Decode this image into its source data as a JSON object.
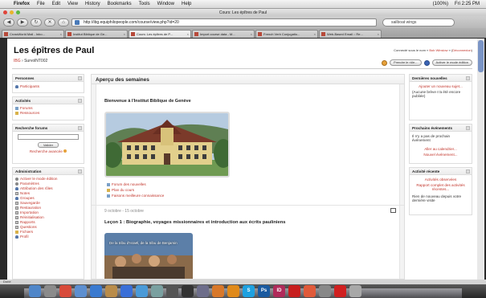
{
  "menubar": {
    "apple": "",
    "app_name": "Firefox",
    "menus": [
      "File",
      "Edit",
      "View",
      "History",
      "Bookmarks",
      "Tools",
      "Window",
      "Help"
    ],
    "clock": "Fri 2:25 PM",
    "battery": "(100%)"
  },
  "window": {
    "title": "Cours: Les épîtres de Paul"
  },
  "toolbar": {
    "url": "http://ibg.equiphilopeople.com/course/view.php?id=20",
    "search_value": "sailboat wings"
  },
  "tabs": [
    {
      "label": "CrossWorld Mail - Inbo...",
      "active": false
    },
    {
      "label": "Institut Biblique de Ge...",
      "active": false
    },
    {
      "label": "Cours: Les épîtres de P...",
      "active": true
    },
    {
      "label": "Import course data - M...",
      "active": false
    },
    {
      "label": "French Verb Conjugatio...",
      "active": false
    },
    {
      "label": "Web-Based Email :: Re...",
      "active": false
    }
  ],
  "header": {
    "site_title": "Les épîtres de Paul",
    "breadcrumb_home": "IBG",
    "breadcrumb_sep": " › ",
    "breadcrumb_course": "SurvolNT002",
    "login_prefix": "Connecté sous le nom « ",
    "login_user": "Bob Winslow",
    "login_suffix": " » (",
    "logout": "Déconnexion",
    "logout_close": ")",
    "role_button": "Prendre le rôle...",
    "edit_button": "Activer le mode édition"
  },
  "left": {
    "people": {
      "title": "Personnes",
      "items": [
        "Participants"
      ]
    },
    "activities": {
      "title": "Activités",
      "items": [
        "Forums",
        "Ressources"
      ]
    },
    "search": {
      "title": "Recherche forums",
      "button": "Valider",
      "advanced": "Recherche avancée"
    },
    "admin": {
      "title": "Administration",
      "items": [
        "Activer le mode édition",
        "Paramètres",
        "Attribution des rôles",
        "Notes",
        "Groupes",
        "Sauvegarde",
        "Restauration",
        "Importation",
        "Réinitialisation",
        "Rapports",
        "Questions",
        "Fichiers",
        "Profil"
      ]
    }
  },
  "main": {
    "heading": "Aperçu des semaines",
    "welcome": "Bienvenue à l'Institut Biblique de Genève",
    "section0_links": [
      "Forum des nouvelles",
      "Plan du cours",
      "Faisons meilleure connaissance"
    ],
    "section1_date": "9 octobre - 15 octobre",
    "section1_title": "Leçon 1 : Biographie, voyages missionnaires et introduction aux écrits pauliniens",
    "image_caption": "De la tribu d'Israël, de la tribu de Benjamin"
  },
  "right": {
    "news": {
      "title": "Dernières nouvelles",
      "add": "Ajouter un nouveau sujet...",
      "empty": "(Aucune brève n'a été encore publiée)"
    },
    "events": {
      "title": "Prochains événements",
      "empty": "Il n'y a pas de prochain événement",
      "calendar": "Aller au calendrier...",
      "new": "Nouvel événement..."
    },
    "recent": {
      "title": "Activité récente",
      "observed": "Activités observées",
      "full_report": "Rapport complet des activités récentes...",
      "nothing": "Rien de nouveau depuis votre dernière visite"
    }
  },
  "status": "Done",
  "colors": {
    "link": "#c2342a",
    "accent_blue": "#3b64b4"
  },
  "dock": [
    {
      "name": "finder-icon",
      "color": "#4f86c9",
      "glyph": ""
    },
    {
      "name": "system-prefs-icon",
      "color": "#8b8b8b",
      "glyph": ""
    },
    {
      "name": "ical-icon",
      "color": "#d84a3a",
      "glyph": ""
    },
    {
      "name": "mail-icon",
      "color": "#5d8fd0",
      "glyph": ""
    },
    {
      "name": "ichat-icon",
      "color": "#3a7ad0",
      "glyph": ""
    },
    {
      "name": "address-book-icon",
      "color": "#b98c4a",
      "glyph": ""
    },
    {
      "name": "itunes-icon",
      "color": "#3a6fd8",
      "glyph": ""
    },
    {
      "name": "safari-icon",
      "color": "#4a9ad8",
      "glyph": ""
    },
    {
      "name": "preview-icon",
      "color": "#7aa0a0",
      "glyph": ""
    },
    {
      "name": "photo-booth-icon",
      "color": "#555",
      "glyph": ""
    },
    {
      "name": "terminal-icon",
      "color": "#333",
      "glyph": ""
    },
    {
      "name": "utility-icon",
      "color": "#6d6d8a",
      "glyph": ""
    },
    {
      "name": "firefox-icon",
      "color": "#d8782a",
      "glyph": ""
    },
    {
      "name": "vlc-icon",
      "color": "#e08a1a",
      "glyph": ""
    },
    {
      "name": "skype-icon",
      "color": "#1ea1e0",
      "glyph": "S"
    },
    {
      "name": "photoshop-icon",
      "color": "#1a5aa0",
      "glyph": "Ps"
    },
    {
      "name": "indesign-icon",
      "color": "#b02a5a",
      "glyph": "ID"
    },
    {
      "name": "acrobat-icon",
      "color": "#c81e1e",
      "glyph": ""
    },
    {
      "name": "app-icon",
      "color": "#e05a3a",
      "glyph": ""
    },
    {
      "name": "printer-icon",
      "color": "#888",
      "glyph": ""
    },
    {
      "name": "pdf-icon",
      "color": "#d02020",
      "glyph": ""
    },
    {
      "name": "trash-icon",
      "color": "#a8a8a8",
      "glyph": ""
    }
  ]
}
